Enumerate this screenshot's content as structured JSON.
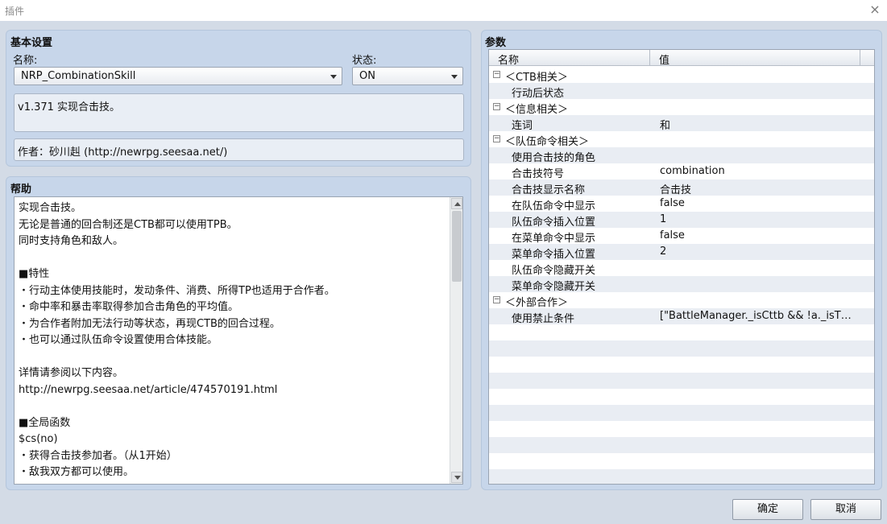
{
  "window": {
    "title": "插件",
    "close_icon": "×"
  },
  "basic": {
    "section_title": "基本设置",
    "name_label": "名称:",
    "name_value": "NRP_CombinationSkill",
    "status_label": "状态:",
    "status_value": "ON",
    "description": "v1.371 实现合击技。",
    "author": "作者：砂川赳 (http://newrpg.seesaa.net/)"
  },
  "help": {
    "section_title": "帮助",
    "lines": [
      "实现合击技。",
      "无论是普通的回合制还是CTB都可以使用TPB。",
      "同时支持角色和敌人。",
      "",
      "■特性",
      "・行动主体使用技能时，发动条件、消费、所得TP也适用于合作者。",
      "・命中率和暴击率取得参加合击角色的平均值。",
      "・为合作者附加无法行动等状态，再现CTB的回合过程。",
      "・也可以通过队伍命令设置使用合体技能。",
      "",
      "详情请参阅以下内容。",
      "http://newrpg.seesaa.net/article/474570191.html",
      "",
      "■全局函数",
      "$cs(no)",
      "・获得合击技参加者。（从1开始）",
      "・敌我双方都可以使用。"
    ]
  },
  "params": {
    "section_title": "参数",
    "col_name": "名称",
    "col_value": "值",
    "rows": [
      {
        "group": true,
        "name": "＜CTB相关＞",
        "value": ""
      },
      {
        "group": false,
        "name": "行动后状态",
        "value": ""
      },
      {
        "group": true,
        "name": "＜信息相关＞",
        "value": ""
      },
      {
        "group": false,
        "name": "连词",
        "value": "和"
      },
      {
        "group": true,
        "name": "＜队伍命令相关＞",
        "value": ""
      },
      {
        "group": false,
        "name": "使用合击技的角色",
        "value": ""
      },
      {
        "group": false,
        "name": "合击技符号",
        "value": "combination"
      },
      {
        "group": false,
        "name": "合击技显示名称",
        "value": "合击技"
      },
      {
        "group": false,
        "name": "在队伍命令中显示",
        "value": "false"
      },
      {
        "group": false,
        "name": "队伍命令插入位置",
        "value": "1"
      },
      {
        "group": false,
        "name": "在菜单命令中显示",
        "value": "false"
      },
      {
        "group": false,
        "name": "菜单命令插入位置",
        "value": "2"
      },
      {
        "group": false,
        "name": "队伍命令隐藏开关",
        "value": ""
      },
      {
        "group": false,
        "name": "菜单命令隐藏开关",
        "value": ""
      },
      {
        "group": true,
        "name": "＜外部合作＞",
        "value": ""
      },
      {
        "group": false,
        "name": "使用禁止条件",
        "value": "[\"BattleManager._isCttb && !a._isT…"
      }
    ],
    "empty_rows": 10
  },
  "buttons": {
    "ok": "确定",
    "cancel": "取消"
  }
}
